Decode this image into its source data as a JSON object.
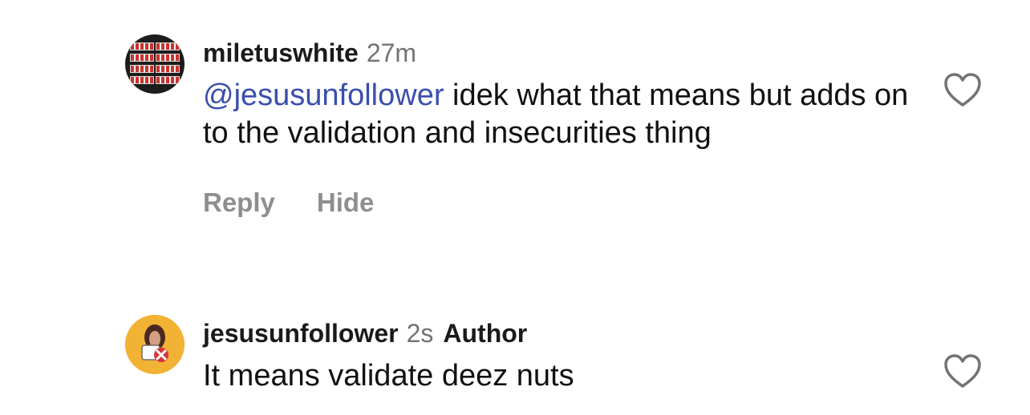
{
  "comments": [
    {
      "username": "miletuswhite",
      "timestamp": "27m",
      "mention": "@jesusunfollower",
      "text": " idek what that means but adds on to the validation and insecurities thing",
      "actions": {
        "reply": "Reply",
        "hide": "Hide"
      },
      "avatar_icon": "poker-hand-rankings-avatar",
      "like_icon": "heart-outline-icon"
    },
    {
      "username": "jesusunfollower",
      "timestamp": "2s",
      "author_label": "Author",
      "text": "It means validate deez nuts",
      "avatar_icon": "jesus-unfollow-avatar",
      "like_icon": "heart-outline-icon"
    }
  ],
  "colors": {
    "mention": "#3a4eb0",
    "secondary_text": "#737373",
    "actions_text": "#8e8e8e",
    "author_avatar_bg": "#f2b233",
    "unfollow_x": "#d8343b"
  }
}
